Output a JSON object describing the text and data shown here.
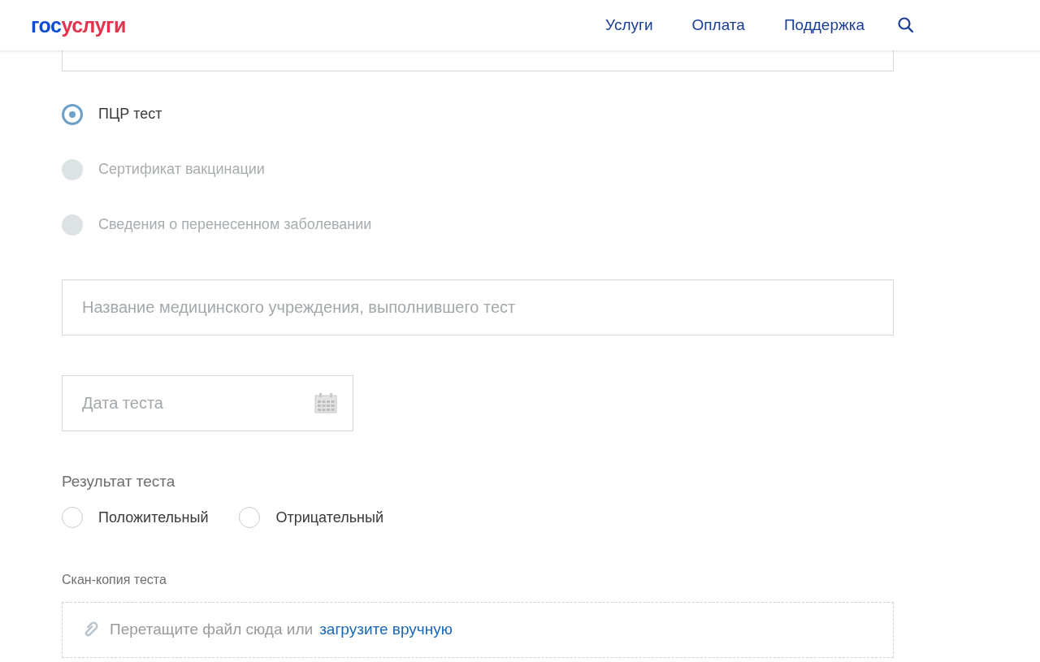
{
  "header": {
    "logo": {
      "first": "гос",
      "second": "услуги"
    },
    "nav": [
      "Услуги",
      "Оплата",
      "Поддержка"
    ]
  },
  "document_type": [
    {
      "label": "ПЦР тест",
      "selected": true,
      "disabled": false
    },
    {
      "label": "Сертификат вакцинации",
      "selected": false,
      "disabled": true
    },
    {
      "label": "Сведения о перенесенном заболевании",
      "selected": false,
      "disabled": true
    }
  ],
  "institution_field": {
    "placeholder": "Название медицинского учреждения, выполнившего тест"
  },
  "date_field": {
    "placeholder": "Дата теста"
  },
  "result": {
    "label": "Результат теста",
    "options": [
      {
        "label": "Положительный",
        "selected": false
      },
      {
        "label": "Отрицательный",
        "selected": false
      }
    ]
  },
  "scan": {
    "label": "Скан-копия теста",
    "hint": "Перетащите файл сюда или",
    "link": "загрузите вручную"
  }
}
